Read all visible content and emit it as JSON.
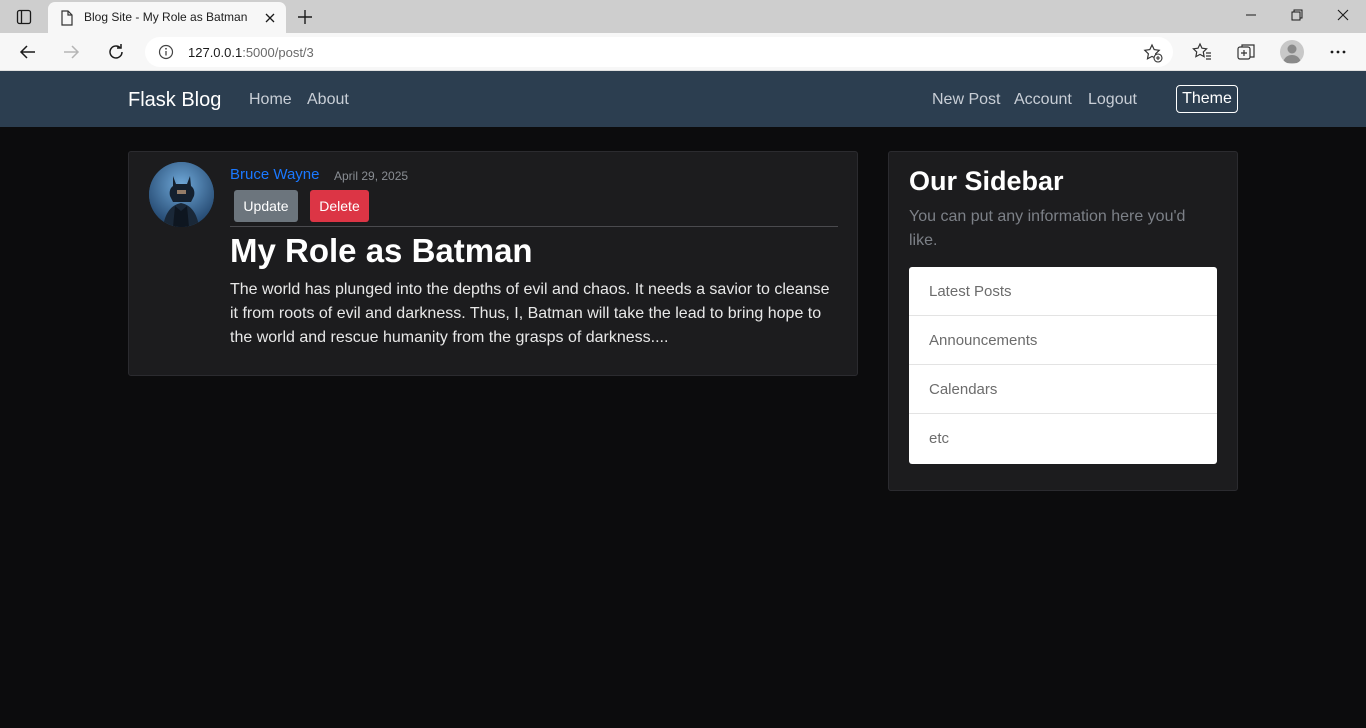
{
  "browser": {
    "tab_title": "Blog Site - My Role as Batman",
    "url_host": "127.0.0.1",
    "url_rest": ":5000/post/3"
  },
  "nav": {
    "brand": "Flask Blog",
    "left_links": [
      "Home",
      "About"
    ],
    "right_links": [
      "New Post",
      "Account",
      "Logout"
    ],
    "theme_label": "Theme"
  },
  "post": {
    "author": "Bruce Wayne",
    "date": "April 29, 2025",
    "update_label": "Update",
    "delete_label": "Delete",
    "title": "My Role as Batman",
    "body": "The world has plunged into the depths of evil and chaos. It needs a savior to cleanse it from roots of evil and darkness. Thus, I, Batman will take the lead to bring hope to the world and rescue humanity from the grasps of darkness...."
  },
  "sidebar": {
    "title": "Our Sidebar",
    "description": "You can put any information here you'd like.",
    "items": [
      "Latest Posts",
      "Announcements",
      "Calendars",
      "etc"
    ]
  },
  "colors": {
    "navbar": "#2c3e50",
    "author_link": "#1a78ff",
    "update_button": "#6c757d",
    "delete_button": "#dc3545"
  }
}
